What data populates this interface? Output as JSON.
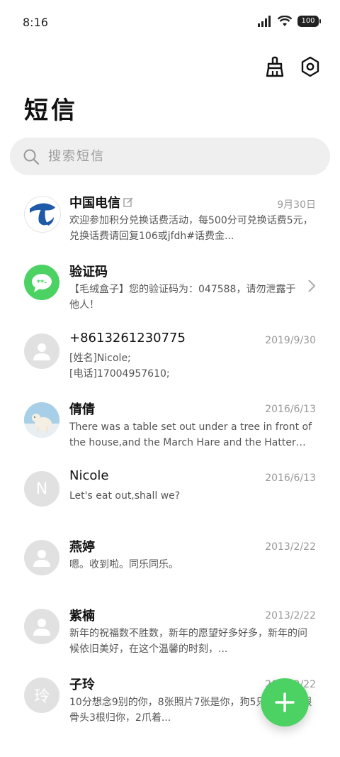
{
  "status_bar": {
    "time": "8:16",
    "battery": "100"
  },
  "header": {
    "title": "短信"
  },
  "search": {
    "placeholder": "搜索短信"
  },
  "conversations": [
    {
      "name": "中国电信",
      "date": "9月30日",
      "preview": "欢迎参加积分兑换话费活动，每500分可兑换话费5元，兑换话费请回复106或jfdh#话费金...",
      "avatar": "telecom-logo"
    },
    {
      "name": "验证码",
      "date": "",
      "preview": "【毛绒盒子】您的验证码为：047588，请勿泄露于他人！",
      "avatar": "message-bubble"
    },
    {
      "name": "+8613261230775",
      "date": "2019/9/30",
      "preview": "[姓名]Nicole;\n[电话]17004957610;",
      "avatar": "default-person"
    },
    {
      "name": "倩倩",
      "date": "2016/6/13",
      "preview": "There was a table set out under a tree in front of the house,and the March Hare and the Hatter were having...",
      "avatar": "polar-bear-photo"
    },
    {
      "name": "Nicole",
      "date": "2016/6/13",
      "preview": "Let's eat out,shall we?",
      "avatar_letter": "N"
    },
    {
      "name": "燕婷",
      "date": "2013/2/22",
      "preview": "嗯。收到啦。同乐同乐。",
      "avatar": "default-person"
    },
    {
      "name": "紫楠",
      "date": "2013/2/22",
      "preview": "新年的祝福数不胜数，新年的愿望好多好多，新年的问候依旧美好，在这个温馨的时刻，...",
      "avatar": "default-person"
    },
    {
      "name": "子玲",
      "date": "2013/2/22",
      "preview": "10分想念9别的你，8张照片7张是你，狗5只像你，4根骨头3根归你，2爪着...",
      "avatar_letter": "玲"
    }
  ],
  "colors": {
    "accent": "#4cd263",
    "avatar_bg": "#e1e1e1",
    "telecom_blue": "#1e5aa8"
  }
}
